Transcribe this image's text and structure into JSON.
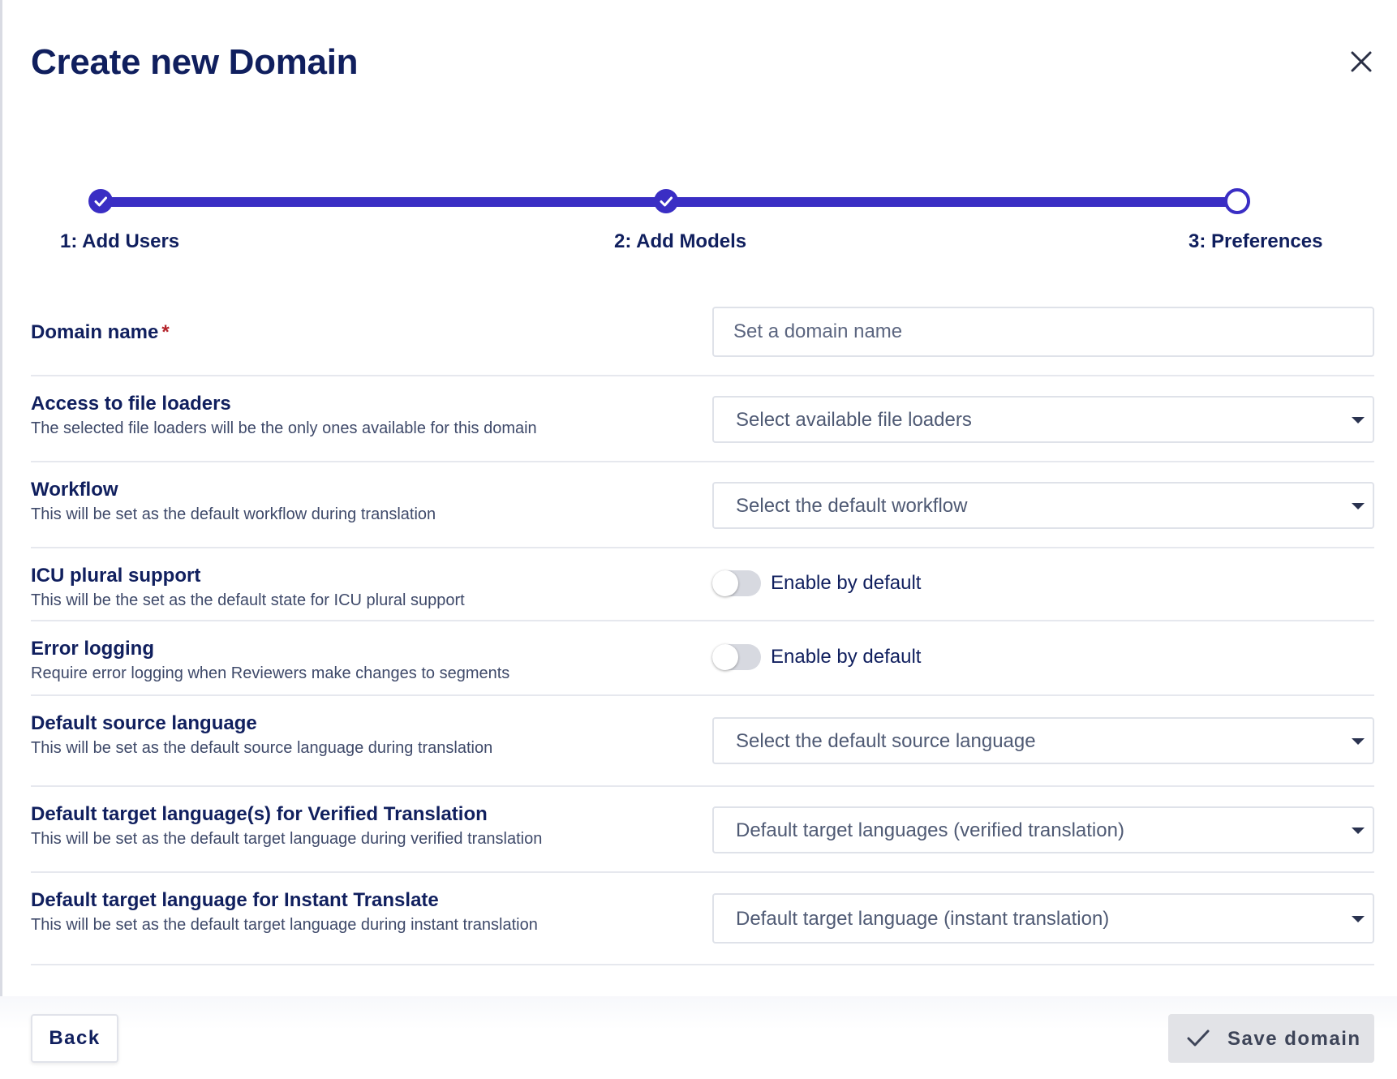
{
  "dialog": {
    "title": "Create new Domain",
    "close_icon": "close-icon"
  },
  "stepper": {
    "steps": [
      {
        "label": "1: Add Users",
        "state": "completed"
      },
      {
        "label": "2: Add Models",
        "state": "completed"
      },
      {
        "label": "3: Preferences",
        "state": "current"
      }
    ],
    "accent_color": "#3a2ec4"
  },
  "form": {
    "domain_name": {
      "label": "Domain name",
      "required_marker": "*",
      "placeholder": "Set a domain name",
      "value": ""
    },
    "file_loaders": {
      "label": "Access to file loaders",
      "description": "The selected file loaders will be the only ones available for this domain",
      "placeholder": "Select available file loaders"
    },
    "workflow": {
      "label": "Workflow",
      "description": "This will be set as the default workflow during translation",
      "placeholder": "Select the default workflow"
    },
    "icu_plural": {
      "label": "ICU plural support",
      "description": "This will be the set as the default state for ICU plural support",
      "toggle_label": "Enable by default",
      "enabled": false
    },
    "error_logging": {
      "label": "Error logging",
      "description": "Require error logging when Reviewers make changes to segments",
      "toggle_label": "Enable by default",
      "enabled": false
    },
    "source_language": {
      "label": "Default source language",
      "description": "This will be set as the default source language during translation",
      "placeholder": "Select the default source language"
    },
    "verified_target": {
      "label": "Default target language(s) for Verified Translation",
      "description": "This will be set as the default target language during verified translation",
      "placeholder": "Default target languages (verified translation)"
    },
    "instant_target": {
      "label": "Default target language for Instant Translate",
      "description": "This will be set as the default target language during instant translation",
      "placeholder": "Default target language (instant translation)"
    }
  },
  "footer": {
    "back_label": "Back",
    "save_label": "Save domain",
    "save_icon": "checkmark-icon"
  }
}
